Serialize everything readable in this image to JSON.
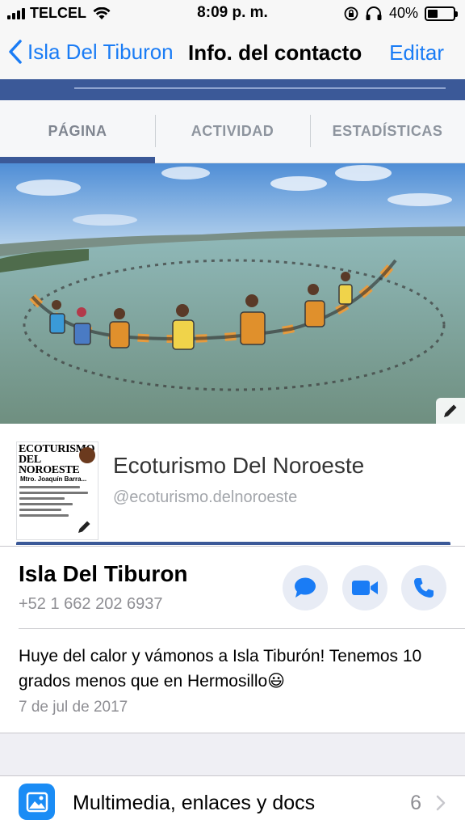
{
  "status_bar": {
    "carrier": "TELCEL",
    "time": "8:09 p. m.",
    "battery": "40%",
    "battery_level": 0.4
  },
  "nav": {
    "back_label": "Isla Del Tiburon",
    "title": "Info. del contacto",
    "edit_label": "Editar"
  },
  "fb_tabs": [
    {
      "label": "PÁGINA",
      "active": true
    },
    {
      "label": "ACTIVIDAD",
      "active": false
    },
    {
      "label": "ESTADÍSTICAS",
      "active": false
    }
  ],
  "page_card": {
    "name": "Ecoturismo Del Noroeste",
    "handle": "@ecoturismo.delnoroeste",
    "thumb_title": "ECOTURISMO DEL NOROESTE",
    "thumb_sub": "Mtro. Joaquín Barra..."
  },
  "contact": {
    "name": "Isla Del Tiburon",
    "phone": "+52 1 662 202 6937",
    "actions": [
      "message-icon",
      "video-icon",
      "phone-icon"
    ]
  },
  "status": {
    "text": "Huye del calor y vámonos a Isla Tiburón! Tenemos 10 grados menos que en Hermosillo😃",
    "date": "7 de jul de 2017"
  },
  "media": {
    "label": "Multimedia, enlaces y docs",
    "count": "6"
  },
  "colors": {
    "ios_blue": "#1a7cf5",
    "facebook_blue": "#3b5998"
  }
}
